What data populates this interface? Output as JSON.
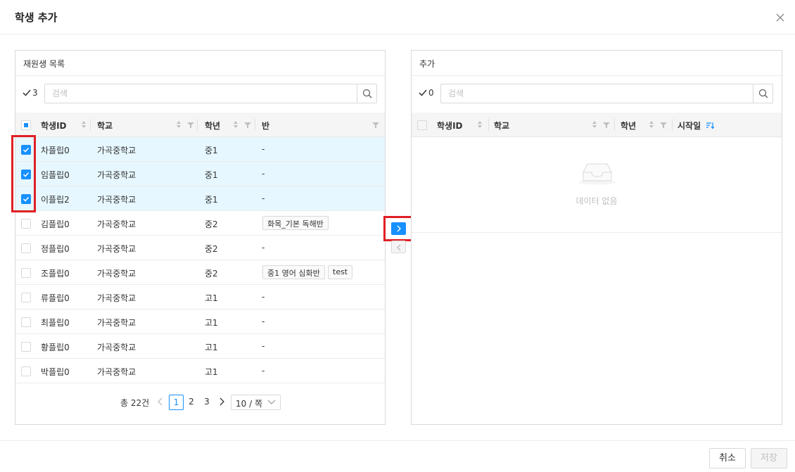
{
  "modal": {
    "title": "학생 추가"
  },
  "left_panel": {
    "title": "재원생 목록",
    "checked_count": "3",
    "search_placeholder": "검색",
    "columns": {
      "student_id": "학생ID",
      "school": "학교",
      "grade": "학년",
      "class": "반"
    },
    "rows": [
      {
        "id": "차플립0",
        "school": "가곡중학교",
        "grade": "중1",
        "classes": [
          "-"
        ],
        "checked": true
      },
      {
        "id": "임플립0",
        "school": "가곡중학교",
        "grade": "중1",
        "classes": [
          "-"
        ],
        "checked": true
      },
      {
        "id": "이플립2",
        "school": "가곡중학교",
        "grade": "중1",
        "classes": [
          "-"
        ],
        "checked": true
      },
      {
        "id": "김플립0",
        "school": "가곡중학교",
        "grade": "중2",
        "classes": [
          "화목_기본 독해반"
        ],
        "checked": false
      },
      {
        "id": "정플립0",
        "school": "가곡중학교",
        "grade": "중2",
        "classes": [
          "-"
        ],
        "checked": false
      },
      {
        "id": "조플립0",
        "school": "가곡중학교",
        "grade": "중2",
        "classes": [
          "중1 영어 심화반",
          "test"
        ],
        "checked": false
      },
      {
        "id": "류플립0",
        "school": "가곡중학교",
        "grade": "고1",
        "classes": [
          "-"
        ],
        "checked": false
      },
      {
        "id": "최플립0",
        "school": "가곡중학교",
        "grade": "고1",
        "classes": [
          "-"
        ],
        "checked": false
      },
      {
        "id": "황플립0",
        "school": "가곡중학교",
        "grade": "고1",
        "classes": [
          "-"
        ],
        "checked": false
      },
      {
        "id": "박플립0",
        "school": "가곡중학교",
        "grade": "고1",
        "classes": [
          "-"
        ],
        "checked": false
      }
    ],
    "pagination": {
      "total": "총 22건",
      "pages": [
        "1",
        "2",
        "3"
      ],
      "current_page": "1",
      "page_size": "10 / 쪽"
    }
  },
  "right_panel": {
    "title": "추가",
    "checked_count": "0",
    "search_placeholder": "검색",
    "columns": {
      "student_id": "학생ID",
      "school": "학교",
      "grade": "학년",
      "start_date": "시작일"
    },
    "empty_text": "데이터 없음"
  },
  "footer": {
    "cancel_label": "취소",
    "save_label": "저장"
  },
  "colors": {
    "primary": "#1890ff",
    "highlight": "#e01f25",
    "selected_row": "#e6f7ff"
  },
  "icons": {
    "close": "close-icon",
    "check": "check-icon",
    "search": "search-icon",
    "sort": "sort-icon",
    "filter": "filter-icon",
    "transfer_right": "chevron-right-icon",
    "transfer_left": "chevron-left-icon",
    "empty": "inbox-icon"
  }
}
